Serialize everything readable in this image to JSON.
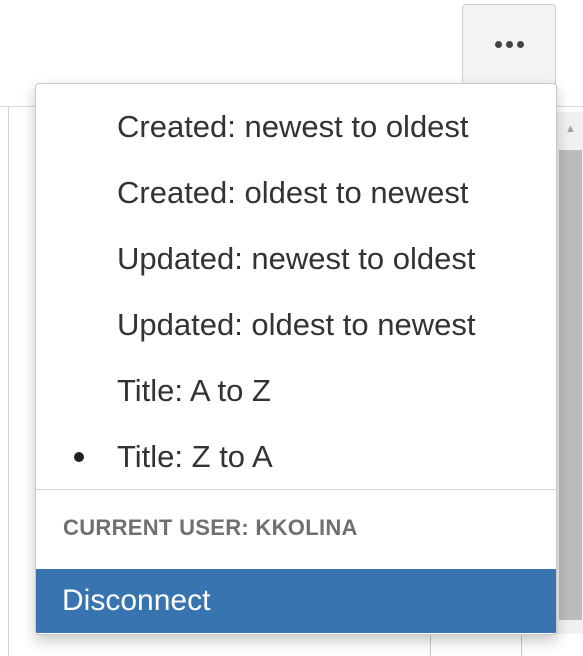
{
  "toolbar": {
    "more_icon": "ellipsis-icon"
  },
  "sort_menu": {
    "items": [
      {
        "label": "Created: newest to oldest",
        "selected": false
      },
      {
        "label": "Created: oldest to newest",
        "selected": false
      },
      {
        "label": "Updated: newest to oldest",
        "selected": false
      },
      {
        "label": "Updated: oldest to newest",
        "selected": false
      },
      {
        "label": "Title: A to Z",
        "selected": false
      },
      {
        "label": "Title: Z to A",
        "selected": true
      }
    ]
  },
  "account": {
    "current_user_label": "CURRENT USER: KKOLINA",
    "disconnect_label": "Disconnect"
  },
  "colors": {
    "highlight": "#3874b0",
    "text": "#333333",
    "muted": "#707070"
  }
}
